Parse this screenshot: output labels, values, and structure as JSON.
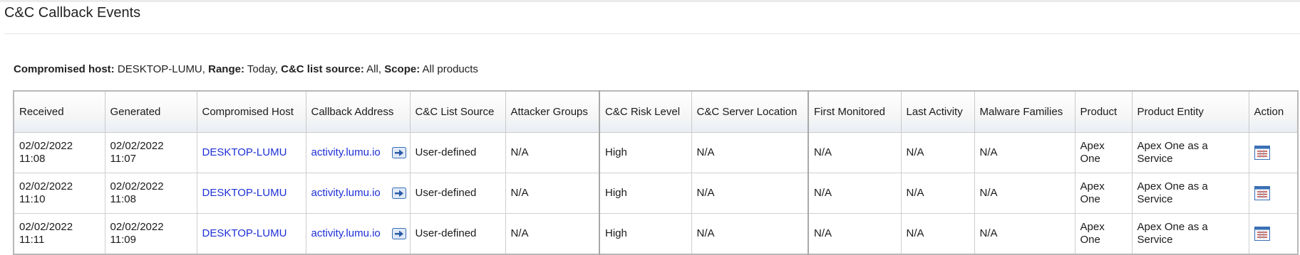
{
  "page": {
    "title": "C&C Callback Events"
  },
  "filters": {
    "host_label": "Compromised host:",
    "host_value": "DESKTOP-LUMU,",
    "range_label": "Range:",
    "range_value": "Today,",
    "source_label": "C&C list source:",
    "source_value": "All,",
    "scope_label": "Scope:",
    "scope_value": "All products"
  },
  "table": {
    "headers": {
      "received": "Received",
      "generated": "Generated",
      "compromised_host": "Compromised Host",
      "callback_address": "Callback Address",
      "list_source": "C&C List Source",
      "attacker_groups": "Attacker Groups",
      "risk_level": "C&C Risk Level",
      "server_location": "C&C Server Location",
      "first_monitored": "First Monitored",
      "last_activity": "Last Activity",
      "malware_families": "Malware Families",
      "product": "Product",
      "product_entity": "Product Entity",
      "action": "Action"
    },
    "rows": [
      {
        "received": "02/02/2022 11:08",
        "generated": "02/02/2022 11:07",
        "host": "DESKTOP-LUMU",
        "address": "activity.lumu.io",
        "source": "User-defined",
        "groups": "N/A",
        "risk": "High",
        "location": "N/A",
        "first": "N/A",
        "last": "N/A",
        "families": "N/A",
        "product": "Apex One",
        "entity": "Apex One as a Service"
      },
      {
        "received": "02/02/2022 11:10",
        "generated": "02/02/2022 11:08",
        "host": "DESKTOP-LUMU",
        "address": "activity.lumu.io",
        "source": "User-defined",
        "groups": "N/A",
        "risk": "High",
        "location": "N/A",
        "first": "N/A",
        "last": "N/A",
        "families": "N/A",
        "product": "Apex One",
        "entity": "Apex One as a Service"
      },
      {
        "received": "02/02/2022 11:11",
        "generated": "02/02/2022 11:09",
        "host": "DESKTOP-LUMU",
        "address": "activity.lumu.io",
        "source": "User-defined",
        "groups": "N/A",
        "risk": "High",
        "location": "N/A",
        "first": "N/A",
        "last": "N/A",
        "families": "N/A",
        "product": "Apex One",
        "entity": "Apex One as a Service"
      }
    ]
  },
  "icons": {
    "callback_jump": "arrow-right-box-icon",
    "action": "log-detail-icon"
  },
  "colors": {
    "link": "#1d2fd6",
    "icon_blue": "#3a6fb5"
  }
}
